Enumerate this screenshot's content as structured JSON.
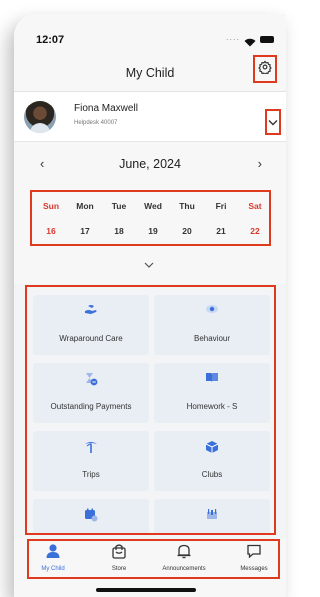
{
  "status_bar": {
    "time": "12:07",
    "signal": "....",
    "icons": [
      "wifi-icon",
      "battery-icon"
    ]
  },
  "header": {
    "title": "My Child",
    "settings_icon": "gear-icon"
  },
  "profile": {
    "name": "Fiona Maxwell",
    "subtitle": "Helpdesk 40007",
    "expand_icon": "chevron-down-icon"
  },
  "calendar": {
    "prev": "‹",
    "next": "›",
    "month_label": "June, 2024",
    "weekdays": [
      "Sun",
      "Mon",
      "Tue",
      "Wed",
      "Thu",
      "Fri",
      "Sat"
    ],
    "dates": [
      "16",
      "17",
      "18",
      "19",
      "20",
      "21",
      "22"
    ],
    "weekend_color": "#d9382c"
  },
  "tiles": [
    {
      "label": "Wraparound Care",
      "icon": "care-hand-icon"
    },
    {
      "label": "Behaviour",
      "icon": "eye-icon"
    },
    {
      "label": "Outstanding Payments",
      "icon": "hourglass-icon"
    },
    {
      "label": "Homework - S",
      "icon": "book-icon"
    },
    {
      "label": "Trips",
      "icon": "palm-tree-icon"
    },
    {
      "label": "Clubs",
      "icon": "cube-icon"
    },
    {
      "label": "",
      "icon": "calendar-clock-icon"
    },
    {
      "label": "",
      "icon": "dining-icon"
    }
  ],
  "tabbar": {
    "items": [
      {
        "label": "My Child",
        "icon": "person-icon",
        "active": true
      },
      {
        "label": "Store",
        "icon": "shopping-bag-icon",
        "active": false
      },
      {
        "label": "Announcements",
        "icon": "bell-icon",
        "active": false
      },
      {
        "label": "Messages",
        "icon": "chat-bubble-icon",
        "active": false
      }
    ]
  },
  "colors": {
    "accent": "#3b6fd9",
    "highlight_box": "#e03a1e",
    "tile_bg": "#e9eef5"
  }
}
